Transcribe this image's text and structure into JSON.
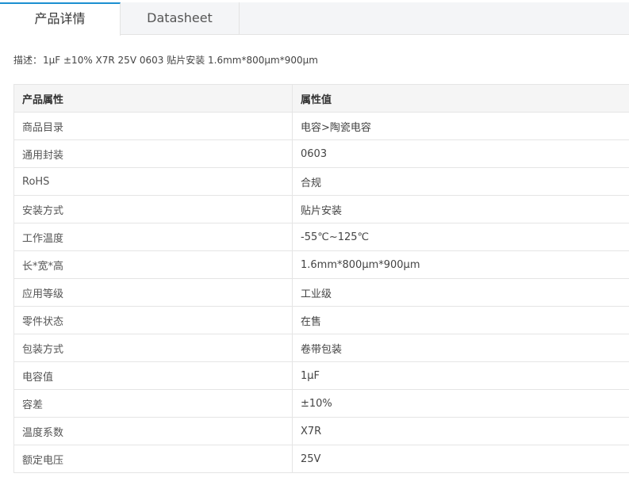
{
  "tabs": [
    {
      "label": "产品详情",
      "active": true
    },
    {
      "label": "Datasheet",
      "active": false
    }
  ],
  "accent_color": "#1c8fd1",
  "description": {
    "label": "描述：",
    "text": "1μF ±10% X7R 25V 0603 贴片安装 1.6mm*800μm*900μm"
  },
  "table": {
    "headers": [
      "产品属性",
      "属性值"
    ],
    "rows": [
      [
        "商品目录",
        "电容>陶瓷电容"
      ],
      [
        "通用封装",
        "0603"
      ],
      [
        "RoHS",
        "合规"
      ],
      [
        "安装方式",
        "贴片安装"
      ],
      [
        "工作温度",
        "-55℃~125℃"
      ],
      [
        "长*宽*高",
        "1.6mm*800μm*900μm"
      ],
      [
        "应用等级",
        "工业级"
      ],
      [
        "零件状态",
        "在售"
      ],
      [
        "包装方式",
        "卷带包装"
      ],
      [
        "电容值",
        "1μF"
      ],
      [
        "容差",
        "±10%"
      ],
      [
        "温度系数",
        "X7R"
      ],
      [
        "额定电压",
        "25V"
      ]
    ]
  }
}
